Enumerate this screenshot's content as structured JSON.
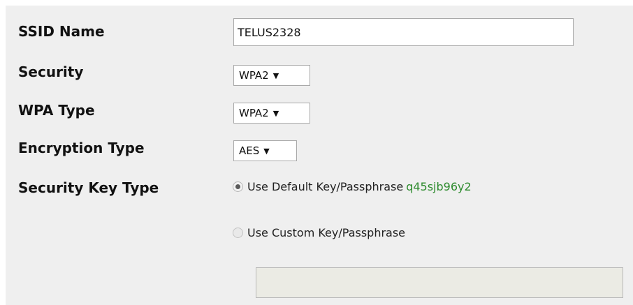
{
  "form": {
    "ssid": {
      "label": "SSID Name",
      "value": "TELUS2328"
    },
    "security": {
      "label": "Security",
      "value": "WPA2"
    },
    "wpa_type": {
      "label": "WPA Type",
      "value": "WPA2"
    },
    "encryption_type": {
      "label": "Encryption Type",
      "value": "AES"
    },
    "security_key_type": {
      "label": "Security Key Type",
      "options": [
        {
          "label": "Use Default Key/Passphrase",
          "key": "q45sjb96y2",
          "checked": true
        },
        {
          "label": "Use Custom Key/Passphrase",
          "checked": false
        }
      ],
      "custom_key_value": ""
    }
  },
  "icons": {
    "dropdown_arrow": "▼"
  },
  "colors": {
    "form_background": "#efefef",
    "default_key_text": "#2e8b2e",
    "disabled_input_background": "#ebebe4"
  }
}
